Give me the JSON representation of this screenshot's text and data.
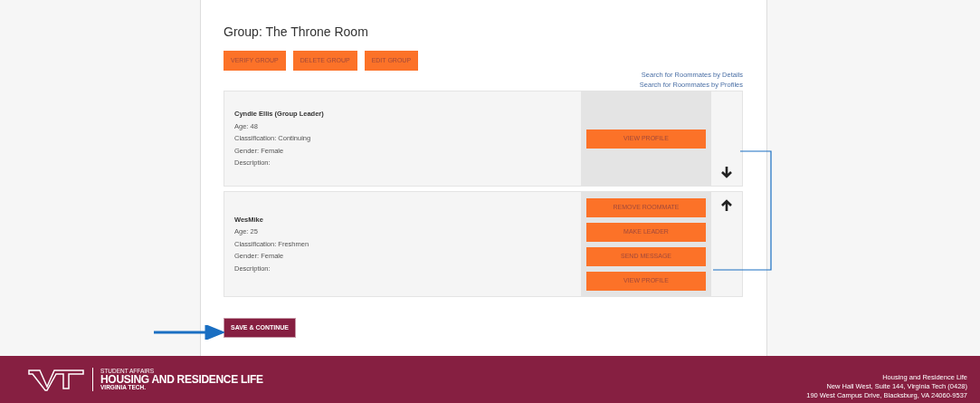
{
  "group_title": "Group: The Throne Room",
  "group_actions": [
    "VERIFY GROUP",
    "DELETE GROUP",
    "EDIT GROUP"
  ],
  "search_links": [
    "Search for Roommates by Details",
    "Search for Roommates by Profiles"
  ],
  "roommates": [
    {
      "name": "Cyndie Ellis (Group Leader)",
      "details": [
        "Age: 48",
        "Classification: Continuing",
        "Gender: Female",
        "Description:"
      ],
      "actions": [
        "VIEW PROFILE"
      ],
      "move_up": false,
      "move_down": true
    },
    {
      "name": "WesMike",
      "details": [
        "Age: 25",
        "Classification: Freshmen",
        "Gender: Female",
        "Description:"
      ],
      "actions": [
        "REMOVE ROOMMATE",
        "MAKE LEADER",
        "SEND MESSAGE",
        "VIEW PROFILE"
      ],
      "move_up": true,
      "move_down": false
    }
  ],
  "save_button": "SAVE & CONTINUE",
  "footer": {
    "logo_small": "STUDENT AFFAIRS",
    "logo_main": "HOUSING AND RESIDENCE LIFE",
    "logo_sub": "VIRGINIA TECH.",
    "address": [
      "Housing and Residence Life",
      "New Hall West, Suite 144, Virginia Tech (0428)",
      "190 West Campus Drive, Blacksburg, VA 24060-9537"
    ]
  }
}
